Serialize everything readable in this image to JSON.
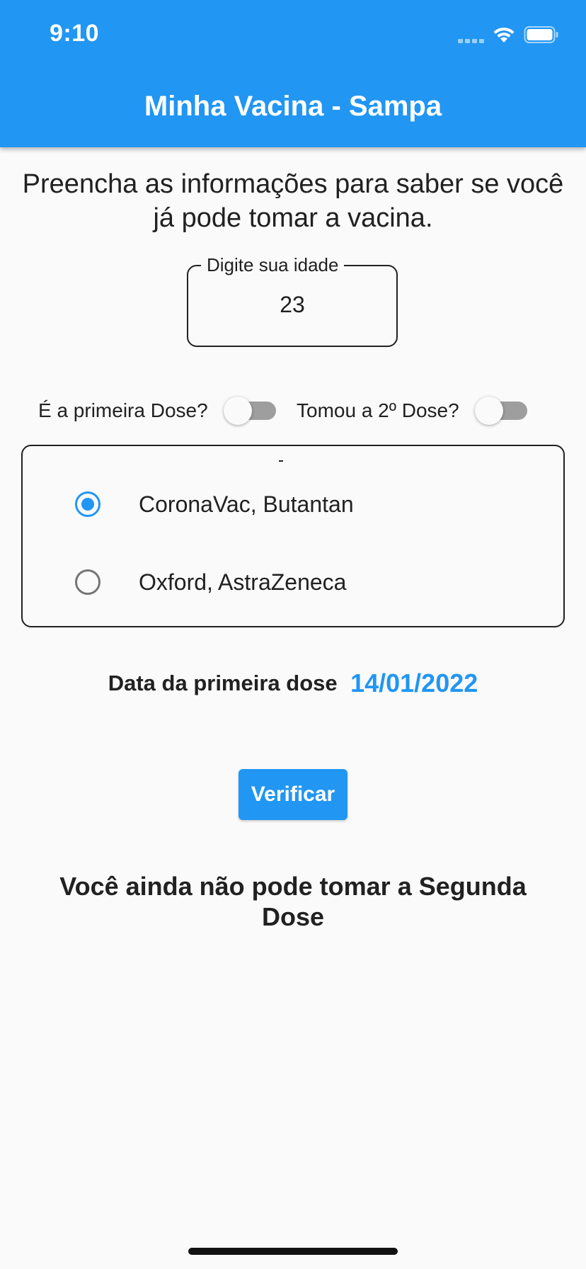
{
  "status_bar": {
    "time": "9:10",
    "icons": [
      "signal-icon",
      "wifi-icon",
      "battery-icon"
    ]
  },
  "app_bar": {
    "title": "Minha Vacina - Sampa",
    "color": "#2196f3"
  },
  "form": {
    "intro": "Preencha as informações para saber se você já pode tomar a vacina.",
    "age_field": {
      "label": "Digite sua idade",
      "value": "23"
    },
    "switches": [
      {
        "label": "É a primeira Dose?",
        "on": false
      },
      {
        "label": "Tomou a 2º Dose?",
        "on": false
      }
    ],
    "vaccine_options": [
      {
        "label": "CoronaVac, Butantan",
        "selected": true
      },
      {
        "label": "Oxford, AstraZeneca",
        "selected": false
      }
    ],
    "first_dose_date": {
      "label": "Data da primeira dose",
      "value": "14/01/2022"
    },
    "verify_button": "Verificar"
  },
  "result": {
    "message": "Você ainda não pode tomar a Segunda Dose"
  }
}
